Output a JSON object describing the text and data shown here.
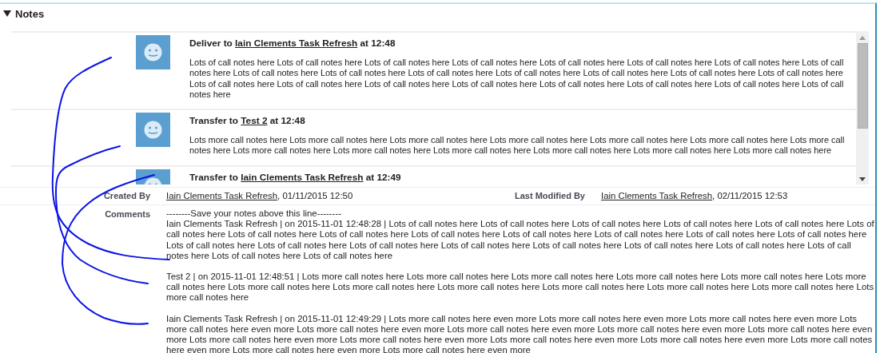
{
  "section": {
    "title": "Notes",
    "expanded": true
  },
  "notes": [
    {
      "action": "Deliver to",
      "link": "Iain Clements Task Refresh",
      "time": "at 12:48",
      "body": "Lots of call notes here Lots of call notes here Lots of call notes here Lots of call notes here Lots of call notes here Lots of call notes here Lots of call notes here Lots of call notes here Lots of call notes here Lots of call notes here Lots of call notes here Lots of call notes here Lots of call notes here Lots of call notes here Lots of call notes here Lots of call notes here Lots of call notes here Lots of call notes here Lots of call notes here Lots of call notes here Lots of call notes here Lots of call notes here Lots of call notes here"
    },
    {
      "action": "Transfer to",
      "link": "Test 2",
      "time": "at 12:48",
      "body": "Lots more call notes here Lots more call notes here Lots more call notes here Lots more call notes here Lots more call notes here Lots more call notes here Lots more call notes here Lots more call notes here Lots more call notes here Lots more call notes here Lots more call notes here Lots more call notes here Lots more call notes here"
    },
    {
      "action": "Transfer to",
      "link": "Iain Clements Task Refresh",
      "time": "at 12:49"
    }
  ],
  "details": {
    "created_by": {
      "label": "Created By",
      "user": "Iain Clements Task Refresh",
      "date": ", 01/11/2015 12:50"
    },
    "last_modified_by": {
      "label": "Last Modified By",
      "user": "Iain Clements Task Refresh",
      "date": ", 02/11/2015 12:53"
    },
    "comments": {
      "label": "Comments",
      "separator": "--------Save your notes above this line--------",
      "entries": [
        "Iain Clements Task Refresh | on 2015-11-01 12:48:28 | Lots of call notes here Lots of call notes here Lots of call notes here Lots of call notes here Lots of call notes here Lots of call notes here Lots of call notes here Lots of call notes here Lots of call notes here Lots of call notes here Lots of call notes here Lots of call notes here Lots of call notes here Lots of call notes here Lots of call notes here Lots of call notes here Lots of call notes here Lots of call notes here Lots of call notes here Lots of call notes here Lots of call notes here Lots of call notes here Lots of call notes here",
        "Test 2 | on 2015-11-01 12:48:51 | Lots more call notes here Lots more call notes here Lots more call notes here Lots more call notes here Lots more call notes here Lots more call notes here Lots more call notes here Lots more call notes here Lots more call notes here Lots more call notes here Lots more call notes here Lots more call notes here Lots more call notes here",
        "Iain Clements Task Refresh | on 2015-11-01 12:49:29 | Lots more call notes here even more Lots more call notes here even more Lots more call notes here even more Lots more call notes here even more Lots more call notes here even more Lots more call notes here even more Lots more call notes here even more Lots more call notes here even more Lots more call notes here even more Lots more call notes here even more Lots more call notes here even more Lots more call notes here even more Lots more call notes here even more Lots more call notes here even more Lots more call notes here even more"
      ]
    }
  }
}
